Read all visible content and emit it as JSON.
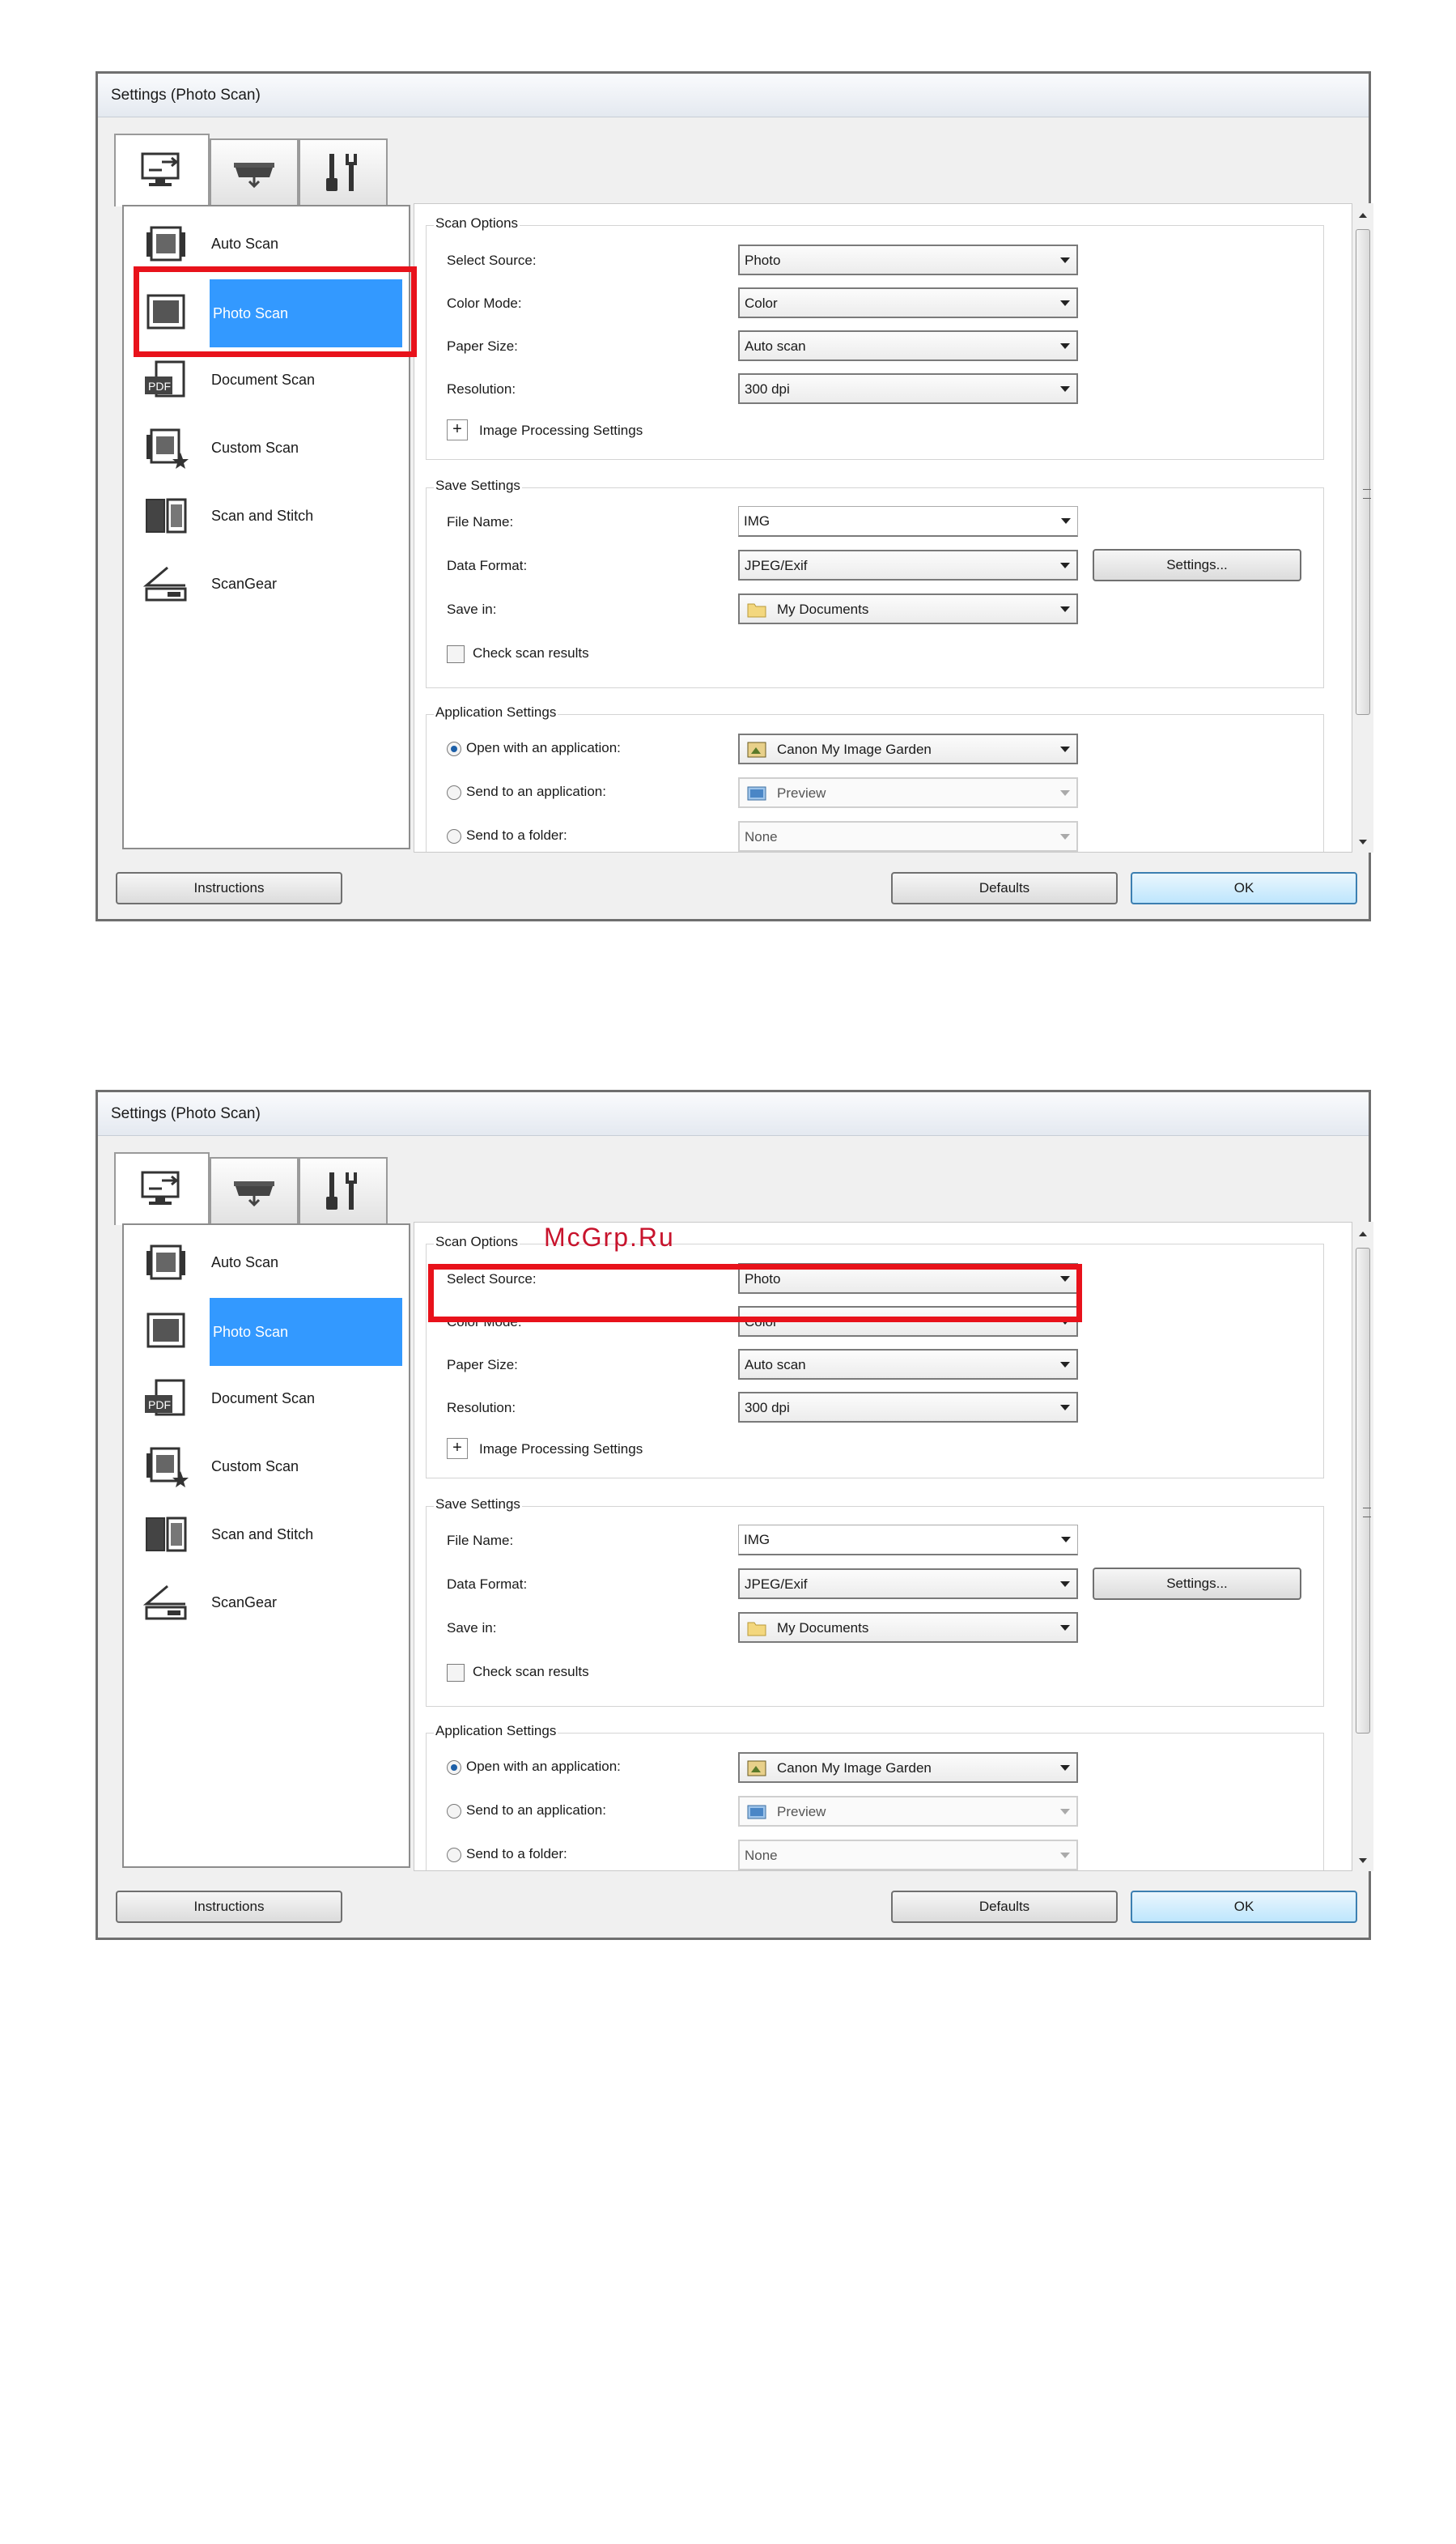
{
  "watermark": "McGrp.Ru",
  "dialogs": [
    {
      "title": "Settings (Photo Scan)",
      "tabs": [
        {
          "name": "scan-from-computer-tab",
          "icon": "computer-scan-icon"
        },
        {
          "name": "scan-from-panel-tab",
          "icon": "scanner-panel-icon"
        },
        {
          "name": "general-settings-tab",
          "icon": "tools-icon"
        }
      ],
      "modes": [
        {
          "label": "Auto Scan",
          "icon": "auto-scan-icon"
        },
        {
          "label": "Photo Scan",
          "icon": "photo-scan-icon"
        },
        {
          "label": "Document Scan",
          "icon": "pdf-document-icon"
        },
        {
          "label": "Custom Scan",
          "icon": "custom-scan-icon"
        },
        {
          "label": "Scan and Stitch",
          "icon": "stitch-icon"
        },
        {
          "label": "ScanGear",
          "icon": "scangear-icon"
        }
      ],
      "scan_options": {
        "title": "Scan Options",
        "select_source_label": "Select Source:",
        "select_source_value": "Photo",
        "color_mode_label": "Color Mode:",
        "color_mode_value": "Color",
        "paper_size_label": "Paper Size:",
        "paper_size_value": "Auto scan",
        "resolution_label": "Resolution:",
        "resolution_value": "300 dpi",
        "image_processing_label": "Image Processing Settings"
      },
      "save_settings": {
        "title": "Save Settings",
        "file_name_label": "File Name:",
        "file_name_value": "IMG",
        "data_format_label": "Data Format:",
        "data_format_value": "JPEG/Exif",
        "settings_button": "Settings...",
        "save_in_label": "Save in:",
        "save_in_value": "My Documents",
        "check_results_label": "Check scan results"
      },
      "app_settings": {
        "title": "Application Settings",
        "open_app_label": "Open with an application:",
        "open_app_value": "Canon My Image Garden",
        "send_app_label": "Send to an application:",
        "send_app_value": "Preview",
        "send_folder_label": "Send to a folder:",
        "send_folder_value": "None"
      },
      "buttons": {
        "instructions": "Instructions",
        "defaults": "Defaults",
        "ok": "OK"
      }
    },
    {
      "title": "Settings (Photo Scan)",
      "tabs": [
        {
          "name": "scan-from-computer-tab",
          "icon": "computer-scan-icon"
        },
        {
          "name": "scan-from-panel-tab",
          "icon": "scanner-panel-icon"
        },
        {
          "name": "general-settings-tab",
          "icon": "tools-icon"
        }
      ],
      "modes": [
        {
          "label": "Auto Scan",
          "icon": "auto-scan-icon"
        },
        {
          "label": "Photo Scan",
          "icon": "photo-scan-icon"
        },
        {
          "label": "Document Scan",
          "icon": "pdf-document-icon"
        },
        {
          "label": "Custom Scan",
          "icon": "custom-scan-icon"
        },
        {
          "label": "Scan and Stitch",
          "icon": "stitch-icon"
        },
        {
          "label": "ScanGear",
          "icon": "scangear-icon"
        }
      ],
      "scan_options": {
        "title": "Scan Options",
        "select_source_label": "Select Source:",
        "select_source_value": "Photo",
        "color_mode_label": "Color Mode:",
        "color_mode_value": "Color",
        "paper_size_label": "Paper Size:",
        "paper_size_value": "Auto scan",
        "resolution_label": "Resolution:",
        "resolution_value": "300 dpi",
        "image_processing_label": "Image Processing Settings"
      },
      "save_settings": {
        "title": "Save Settings",
        "file_name_label": "File Name:",
        "file_name_value": "IMG",
        "data_format_label": "Data Format:",
        "data_format_value": "JPEG/Exif",
        "settings_button": "Settings...",
        "save_in_label": "Save in:",
        "save_in_value": "My Documents",
        "check_results_label": "Check scan results"
      },
      "app_settings": {
        "title": "Application Settings",
        "open_app_label": "Open with an application:",
        "open_app_value": "Canon My Image Garden",
        "send_app_label": "Send to an application:",
        "send_app_value": "Preview",
        "send_folder_label": "Send to a folder:",
        "send_folder_value": "None"
      },
      "buttons": {
        "instructions": "Instructions",
        "defaults": "Defaults",
        "ok": "OK"
      }
    }
  ],
  "colors": {
    "selection": "#3399ff",
    "highlight": "#e8121b",
    "watermark": "#c8142d"
  }
}
